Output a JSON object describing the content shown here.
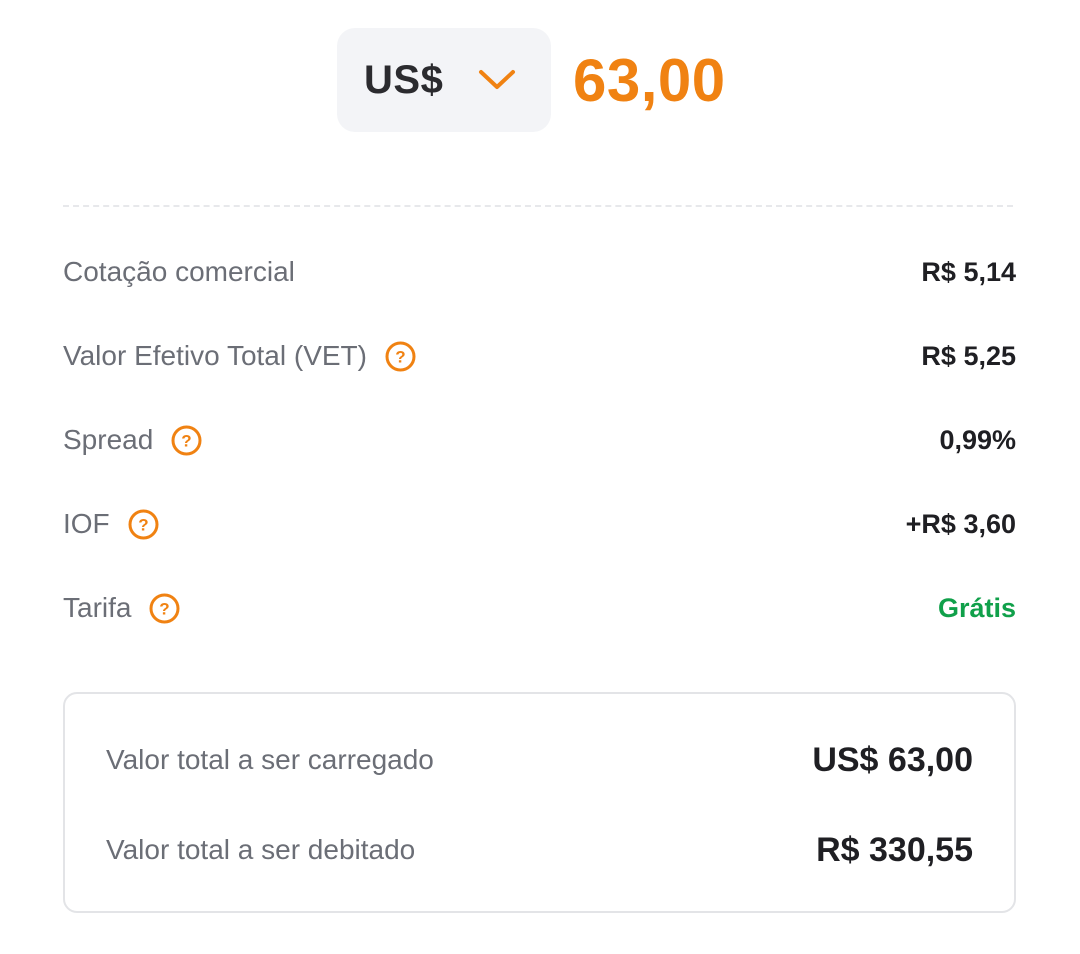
{
  "exchange": {
    "currency": "US$",
    "amount": "63,00"
  },
  "details": [
    {
      "label": "Cotação comercial",
      "value": "R$ 5,14",
      "has_help": false
    },
    {
      "label": "Valor Efetivo Total (VET)",
      "value": "R$ 5,25",
      "has_help": true
    },
    {
      "label": "Spread",
      "value": "0,99%",
      "has_help": true
    },
    {
      "label": "IOF",
      "value": "+R$ 3,60",
      "has_help": true
    },
    {
      "label": "Tarifa",
      "value": "Grátis",
      "has_help": true
    }
  ],
  "totals": {
    "loaded_label": "Valor total a ser carregado",
    "loaded_value": "US$ 63,00",
    "debited_label": "Valor total a ser debitado",
    "debited_value": "R$ 330,55"
  },
  "icons": {
    "currency_dropdown": "chevron-down-icon",
    "help": "help-circle-icon"
  },
  "colors": {
    "accent": "#f08212",
    "free": "#10a04a"
  }
}
